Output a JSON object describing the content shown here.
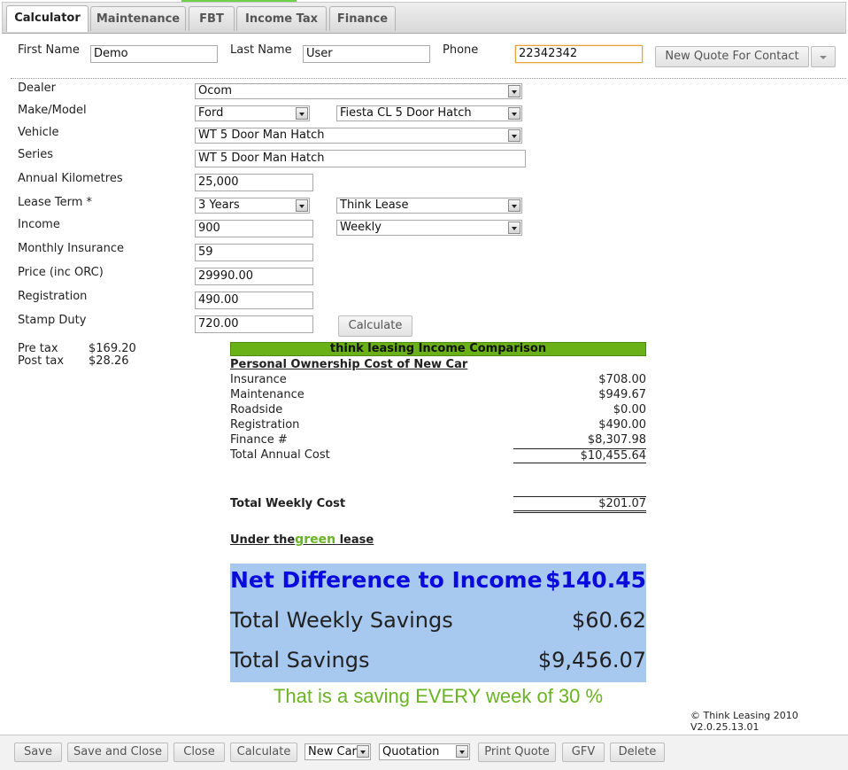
{
  "tabs": [
    "Calculator",
    "Maintenance",
    "FBT",
    "Income Tax",
    "Finance"
  ],
  "contact": {
    "first_name_label": "First Name",
    "first_name": "Demo",
    "last_name_label": "Last Name",
    "last_name": "User",
    "phone_label": "Phone",
    "phone": "22342342",
    "new_quote_label": "New Quote For Contact"
  },
  "form": {
    "dealer_label": "Dealer",
    "dealer": "Ocom",
    "make_model_label": "Make/Model",
    "make": "Ford",
    "model": "Fiesta CL 5 Door Hatch",
    "vehicle_label": "Vehicle",
    "vehicle": "WT 5 Door Man Hatch",
    "series_label": "Series",
    "series": "WT 5 Door  Man Hatch",
    "annual_km_label": "Annual Kilometres",
    "annual_km": "25,000",
    "lease_term_label": "Lease Term *",
    "lease_term": "3 Years",
    "lease_type": "Think Lease",
    "income_label": "Income",
    "income": "900",
    "income_freq": "Weekly",
    "monthly_ins_label": "Monthly Insurance",
    "monthly_ins": "59",
    "price_label": "Price (inc ORC)",
    "price": "29990.00",
    "registration_label": "Registration",
    "registration": "490.00",
    "stamp_duty_label": "Stamp Duty",
    "stamp_duty": "720.00",
    "calculate_label": "Calculate"
  },
  "tax": {
    "pre_label": "Pre tax",
    "pre_value": "$169.20",
    "post_label": "Post tax",
    "post_value": "$28.26"
  },
  "comparison": {
    "header": "think leasing Income Comparison",
    "section_title": "Personal Ownership Cost of New Car",
    "rows": [
      {
        "label": "Insurance",
        "value": "$708.00"
      },
      {
        "label": "Maintenance",
        "value": "$949.67"
      },
      {
        "label": "Roadside",
        "value": "$0.00"
      },
      {
        "label": "Registration",
        "value": "$490.00"
      },
      {
        "label": "Finance #",
        "value": "$8,307.98"
      },
      {
        "label": "Total Annual Cost",
        "value": "$10,455.64"
      }
    ],
    "weekly_label": "Total Weekly Cost",
    "weekly_value": "$201.07",
    "under_prefix": "Under the",
    "under_green": "green",
    "under_suffix": " lease",
    "net_label": "Net Difference to Income",
    "net_value": "$140.45",
    "weekly_savings_label": "Total Weekly Savings",
    "weekly_savings_value": "$60.62",
    "total_savings_label": "Total Savings",
    "total_savings_value": "$9,456.07",
    "saving_text": "That is a saving EVERY week of 30 %"
  },
  "footer": {
    "copyright": "© Think Leasing 2010",
    "version": "V2.0.25.13.01"
  },
  "bottom": {
    "save": "Save",
    "save_close": "Save and Close",
    "close": "Close",
    "calculate": "Calculate",
    "car_type": "New Car",
    "doc_type": "Quotation",
    "print": "Print Quote",
    "gfv": "GFV",
    "delete": "Delete"
  },
  "colors": {
    "green_bar": "#6ab017",
    "blue_block": "#a7c8ef",
    "net_blue": "#0a0adc",
    "green_text": "#6ab423"
  }
}
